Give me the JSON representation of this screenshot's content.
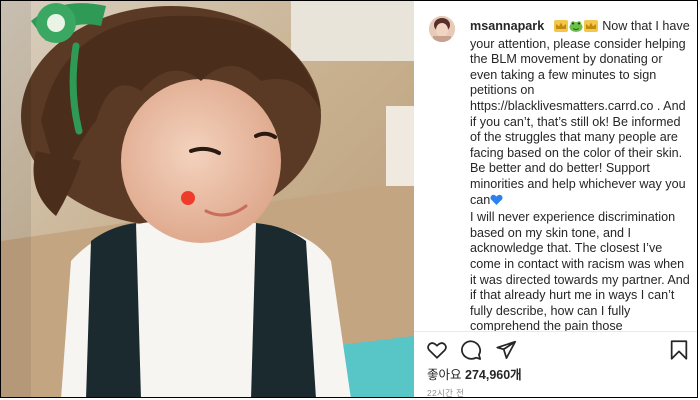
{
  "post": {
    "username": "msannapark",
    "caption_emojis": [
      "crown",
      "frog",
      "crown"
    ],
    "caption_body": "Now that I have your attention, please consider helping the BLM movement by donating or even taking a few minutes to sign petitions on https://blacklivesmatters.carrd.co . And if you can’t, that’s still ok! Be informed of the struggles that many people are facing based on the color of their skin. Be better and do better! Support minorities and help whichever way you can",
    "heart_emoji": "blue-heart",
    "caption_body_2": "I will never experience discrimination based on my skin tone, and I acknowledge that. The closest I’ve come in contact with racism was when it was directed towards my partner. And if that already hurt me in ways I can’t fully describe, how can I fully comprehend the pain those",
    "likes_label": "좋아요",
    "likes_count": "274,960개",
    "timestamp": "22시간 전"
  },
  "icons": {
    "like": "heart-outline-icon",
    "comment": "comment-bubble-icon",
    "share": "paper-plane-icon",
    "save": "bookmark-icon"
  },
  "colors": {
    "text": "#262626",
    "muted": "#8e8e8e",
    "blue_heart": "#2f80ed",
    "border": "#000000"
  }
}
